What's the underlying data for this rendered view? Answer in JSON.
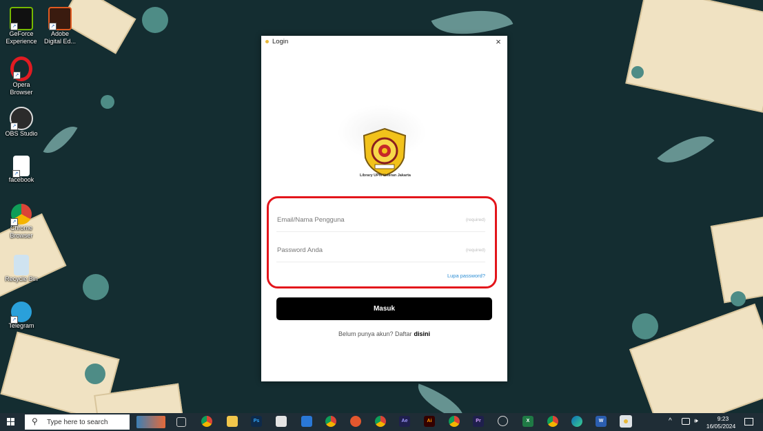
{
  "desktop": {
    "icons": [
      {
        "label": "GeForce\nExperience"
      },
      {
        "label": "Adobe\nDigital Ed..."
      },
      {
        "label": "Opera\nBrowser"
      },
      {
        "label": "OBS Studio"
      },
      {
        "label": "facebook"
      },
      {
        "label": "Chrome\nBrowser"
      },
      {
        "label": "Recycle Bin"
      },
      {
        "label": "Telegram"
      }
    ]
  },
  "login": {
    "title": "Login",
    "close_glyph": "×",
    "logo_caption": "Library UPN Veteran Jakarta",
    "email_placeholder": "Email/Nama Pengguna",
    "email_hint": "(required)",
    "password_placeholder": "Password Anda",
    "password_hint": "(required)",
    "forgot_label": "Lupa password?",
    "submit_label": "Masuk",
    "register_text": "Belum punya akun? Daftar",
    "register_link": "disini",
    "accent_color": "#2d8ed4",
    "highlight_color": "#e3151b"
  },
  "taskbar": {
    "search_placeholder": "Type here to search",
    "search_glyph": "⚲",
    "apps": [
      "task-view",
      "chrome",
      "file-explorer",
      "photoshop",
      "calculator",
      "photos",
      "chrome-profile",
      "opera",
      "chrome-canary",
      "after-effects",
      "illustrator",
      "chrome-alt",
      "premiere-pro",
      "media-player",
      "excel",
      "chrome-dev",
      "edge",
      "word",
      "library-app"
    ],
    "tray_chevron": "^",
    "tray_volume": "🕪",
    "time": "9:23",
    "date": "16/05/2024"
  }
}
